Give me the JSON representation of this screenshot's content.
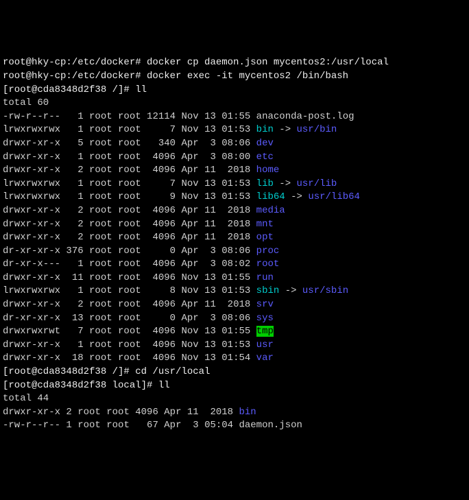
{
  "lines": {
    "prompt1_text": "root@hky-cp:/etc/docker# docker cp daemon.json mycentos2:/usr/local",
    "prompt2_text": "root@hky-cp:/etc/docker# docker exec -it mycentos2 /bin/bash",
    "prompt3_pre": "[root@cda8348d2f38 /]# ",
    "prompt3_cmd": "ll",
    "total1": "total 60",
    "row1": {
      "perm": "-rw-r--r--",
      "links": "   1",
      "own": " root root",
      "size": " 12114",
      "date": " Nov 13 01:55",
      "name": " anaconda-post.log",
      "target": ""
    },
    "row2": {
      "perm": "lrwxrwxrwx",
      "links": "   1",
      "own": " root root",
      "size": "     7",
      "date": " Nov 13 01:53",
      "name": " bin",
      "arrow": " -> ",
      "target": "usr/bin"
    },
    "row3": {
      "perm": "drwxr-xr-x",
      "links": "   5",
      "own": " root root",
      "size": "   340",
      "date": " Apr  3 08:06",
      "name": " dev",
      "target": ""
    },
    "row4": {
      "perm": "drwxr-xr-x",
      "links": "   1",
      "own": " root root",
      "size": "  4096",
      "date": " Apr  3 08:00",
      "name": " etc",
      "target": ""
    },
    "row5": {
      "perm": "drwxr-xr-x",
      "links": "   2",
      "own": " root root",
      "size": "  4096",
      "date": " Apr 11  2018",
      "name": " home",
      "target": ""
    },
    "row6": {
      "perm": "lrwxrwxrwx",
      "links": "   1",
      "own": " root root",
      "size": "     7",
      "date": " Nov 13 01:53",
      "name": " lib",
      "arrow": " -> ",
      "target": "usr/lib"
    },
    "row7": {
      "perm": "lrwxrwxrwx",
      "links": "   1",
      "own": " root root",
      "size": "     9",
      "date": " Nov 13 01:53",
      "name": " lib64",
      "arrow": " -> ",
      "target": "usr/lib64"
    },
    "row8": {
      "perm": "drwxr-xr-x",
      "links": "   2",
      "own": " root root",
      "size": "  4096",
      "date": " Apr 11  2018",
      "name": " media",
      "target": ""
    },
    "row9": {
      "perm": "drwxr-xr-x",
      "links": "   2",
      "own": " root root",
      "size": "  4096",
      "date": " Apr 11  2018",
      "name": " mnt",
      "target": ""
    },
    "row10": {
      "perm": "drwxr-xr-x",
      "links": "   2",
      "own": " root root",
      "size": "  4096",
      "date": " Apr 11  2018",
      "name": " opt",
      "target": ""
    },
    "row11": {
      "perm": "dr-xr-xr-x",
      "links": " 376",
      "own": " root root",
      "size": "     0",
      "date": " Apr  3 08:06",
      "name": " proc",
      "target": ""
    },
    "row12": {
      "perm": "dr-xr-x---",
      "links": "   1",
      "own": " root root",
      "size": "  4096",
      "date": " Apr  3 08:02",
      "name": " root",
      "target": ""
    },
    "row13": {
      "perm": "drwxr-xr-x",
      "links": "  11",
      "own": " root root",
      "size": "  4096",
      "date": " Nov 13 01:55",
      "name": " run",
      "target": ""
    },
    "row14": {
      "perm": "lrwxrwxrwx",
      "links": "   1",
      "own": " root root",
      "size": "     8",
      "date": " Nov 13 01:53",
      "name": " sbin",
      "arrow": " -> ",
      "target": "usr/sbin"
    },
    "row15": {
      "perm": "drwxr-xr-x",
      "links": "   2",
      "own": " root root",
      "size": "  4096",
      "date": " Apr 11  2018",
      "name": " srv",
      "target": ""
    },
    "row16": {
      "perm": "dr-xr-xr-x",
      "links": "  13",
      "own": " root root",
      "size": "     0",
      "date": " Apr  3 08:06",
      "name": " sys",
      "target": ""
    },
    "row17": {
      "perm": "drwxrwxrwt",
      "links": "   7",
      "own": " root root",
      "size": "  4096",
      "date": " Nov 13 01:55",
      "name": " tmp",
      "target": ""
    },
    "row18": {
      "perm": "drwxr-xr-x",
      "links": "   1",
      "own": " root root",
      "size": "  4096",
      "date": " Nov 13 01:53",
      "name": " usr",
      "target": ""
    },
    "row19": {
      "perm": "drwxr-xr-x",
      "links": "  18",
      "own": " root root",
      "size": "  4096",
      "date": " Nov 13 01:54",
      "name": " var",
      "target": ""
    },
    "prompt4_pre": "[root@cda8348d2f38 /]# ",
    "prompt4_cmd": "cd /usr/local",
    "prompt5_pre": "[root@cda8348d2f38 local]# ",
    "prompt5_cmd": "ll",
    "total2": "total 44",
    "row20": {
      "perm": "drwxr-xr-x",
      "links": " 2",
      "own": " root root",
      "size": " 4096",
      "date": " Apr 11  2018",
      "name": " bin",
      "target": ""
    },
    "row21": {
      "perm": "-rw-r--r--",
      "links": " 1",
      "own": " root root",
      "size": "   67",
      "date": " Apr  3 05:04",
      "name": " daemon.json",
      "target": ""
    }
  }
}
